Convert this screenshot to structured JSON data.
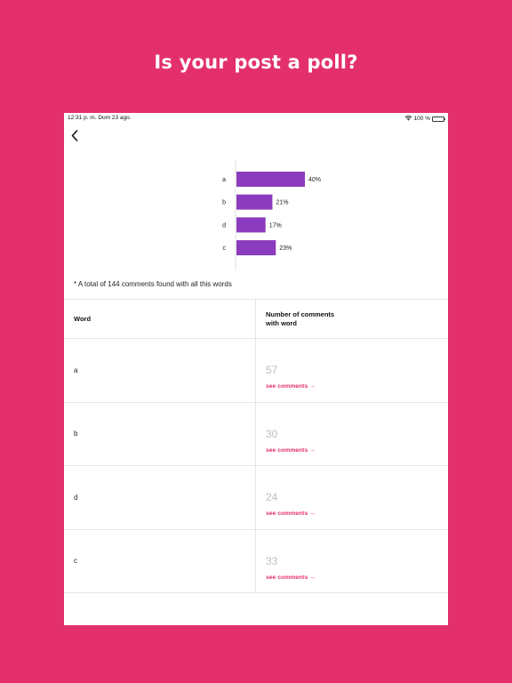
{
  "headline": "Is your post a poll?",
  "status_bar": {
    "time": "12:31 p. m.   Dom 23 ago.",
    "battery": "100 %"
  },
  "colors": {
    "background": "#e3306c",
    "bar": "#8b3bbd",
    "link": "#e3306c"
  },
  "chart_data": {
    "type": "bar",
    "orientation": "horizontal",
    "categories": [
      "a",
      "b",
      "d",
      "c"
    ],
    "values": [
      40,
      21,
      17,
      23
    ],
    "labels": [
      "40%",
      "21%",
      "17%",
      "23%"
    ],
    "xlim": [
      0,
      100
    ]
  },
  "note": "* A total of 144 comments found with all this words",
  "table": {
    "headers": {
      "word": "Word",
      "count_line1": "Number of comments",
      "count_line2": "with word"
    },
    "rows": [
      {
        "word": "a",
        "count": "57",
        "link": "see comments →"
      },
      {
        "word": "b",
        "count": "30",
        "link": "see comments →"
      },
      {
        "word": "d",
        "count": "24",
        "link": "see comments →"
      },
      {
        "word": "c",
        "count": "33",
        "link": "see comments →"
      }
    ]
  }
}
